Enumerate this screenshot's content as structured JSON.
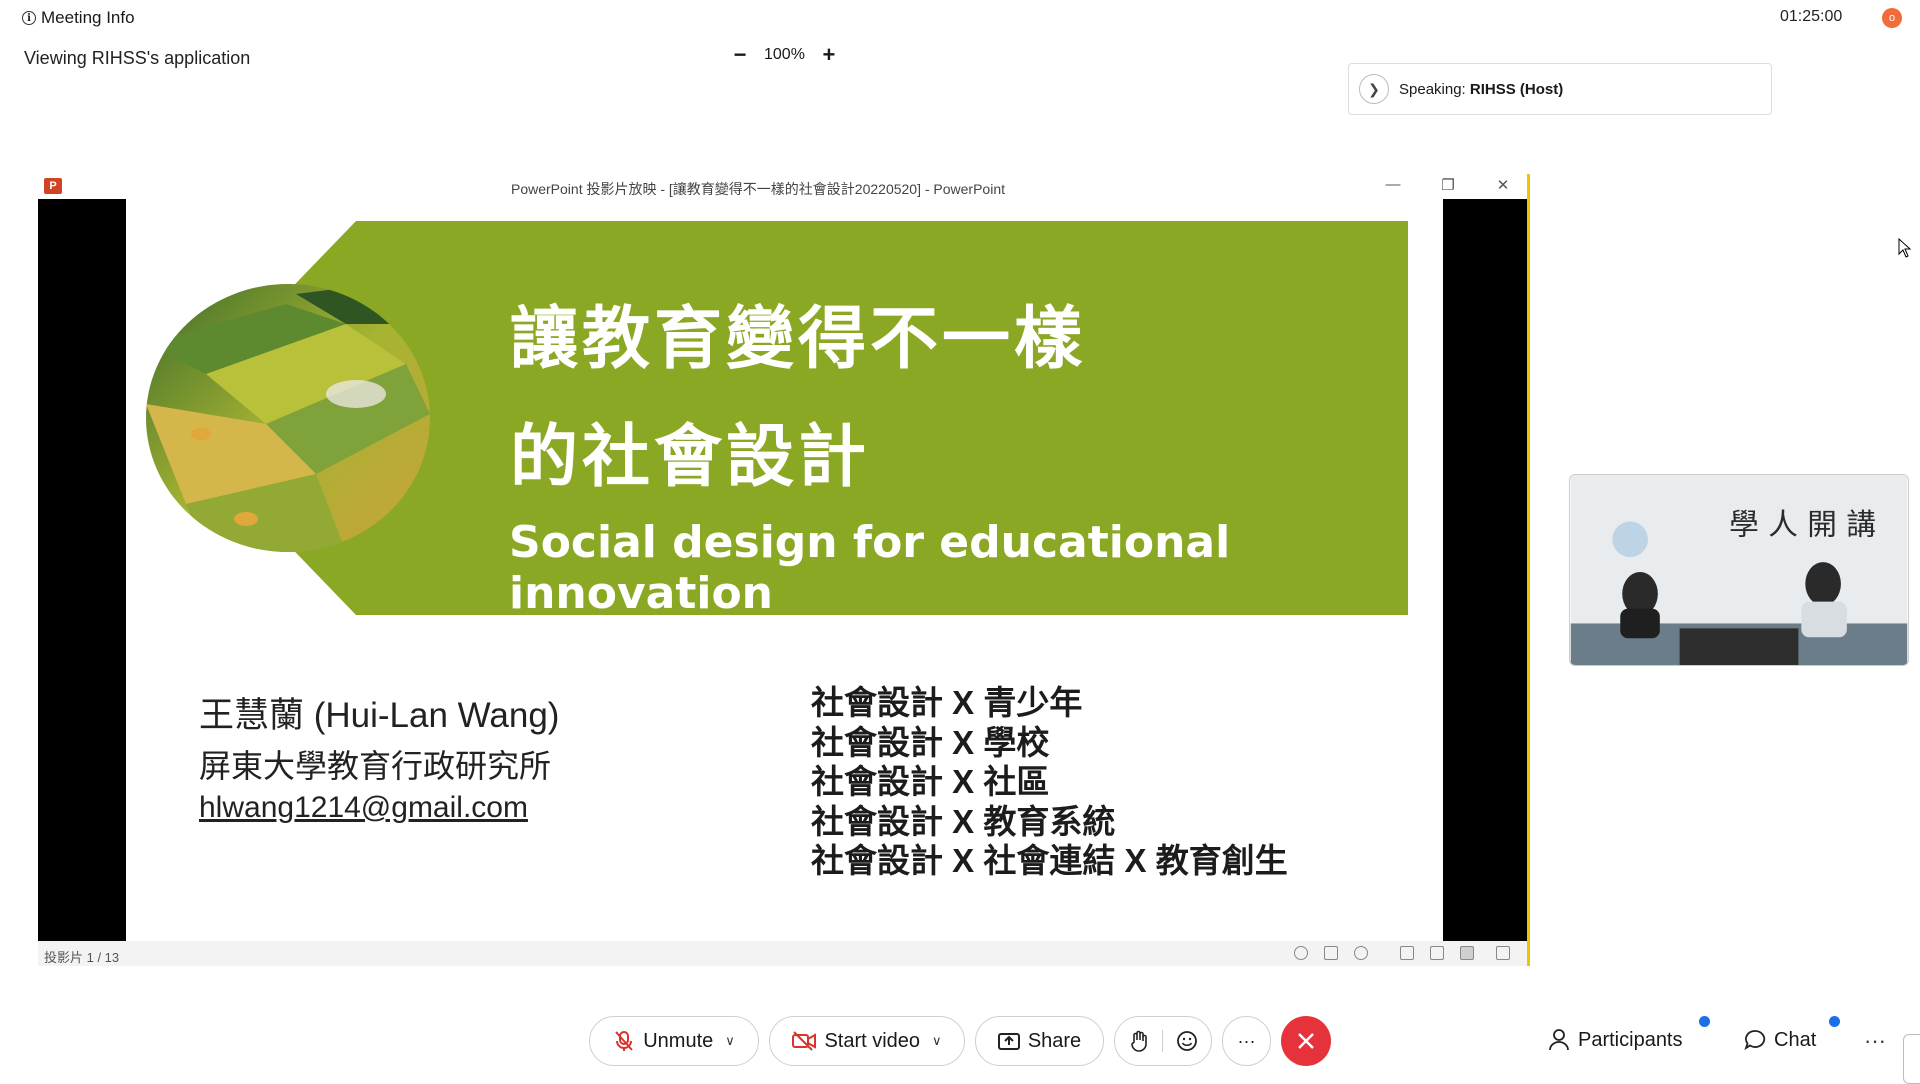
{
  "topbar": {
    "meeting_info_label": "Meeting Info",
    "timer": "01:25:00",
    "rec_badge": "o",
    "viewing_text": "Viewing RIHSS's application",
    "zoom_level": "100%",
    "zoom_minus": "−",
    "zoom_plus": "+"
  },
  "speaking": {
    "prefix": "Speaking: ",
    "name": "RIHSS (Host)"
  },
  "powerpoint": {
    "window_title": "PowerPoint 投影片放映 - [讓教育變得不一樣的社會設計20220520] - PowerPoint",
    "logo_letter": "P",
    "status_slide": "投影片 1 / 13",
    "slide": {
      "title_line1": "讓教育變得不一樣",
      "title_line2": "的社會設計",
      "subtitle": "Social design for educational innovation",
      "author": "王慧蘭 (Hui-Lan Wang)",
      "affiliation": "屏東大學教育行政研究所",
      "email": "hlwang1214@gmail.com",
      "topics": [
        "社會設計 X  青少年",
        "社會設計 X  學校",
        "社會設計 X  社區",
        "社會設計 X  教育系統",
        "社會設計 X  社會連結 X 教育創生"
      ],
      "banner_color": "#8aa823"
    }
  },
  "toolbar": {
    "unmute_label": "Unmute",
    "start_video_label": "Start video",
    "share_label": "Share",
    "more_label": "···",
    "participants_label": "Participants",
    "chat_label": "Chat",
    "overflow_label": "···",
    "end_color": "#e5323b",
    "notify_color": "#1b6fe8"
  },
  "icons": [
    "info-icon",
    "chevron-right-icon",
    "powerpoint-icon",
    "minimize-icon",
    "restore-icon",
    "close-icon",
    "mic-muted-icon",
    "video-off-icon",
    "share-icon",
    "raise-hand-icon",
    "reactions-icon",
    "end-call-icon",
    "participants-icon",
    "chat-icon",
    "mouse-cursor-icon"
  ]
}
